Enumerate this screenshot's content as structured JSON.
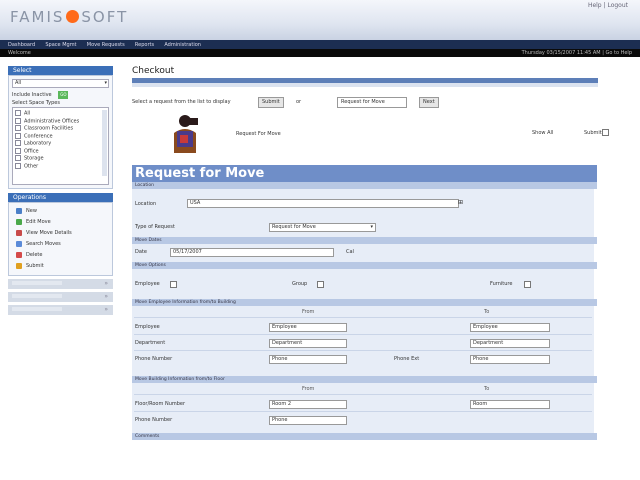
{
  "colors": {
    "accent": "#3b6fb8",
    "banner": "#6f8ec8",
    "logo_dot": "#ff6a1a",
    "nav_dark": "#1c2e52"
  },
  "header": {
    "logo_left": "FAMIS",
    "logo_right": "SOFT",
    "right_links": "Help | Logout"
  },
  "topnav": {
    "items": [
      "Dashboard",
      "Space Mgmt",
      "Move Requests",
      "Reports",
      "Administration"
    ]
  },
  "subbar": {
    "left": "Welcome",
    "right": "Thursday 03/15/2007 11:45 AM | Go to Help"
  },
  "sidebar": {
    "select_title": "Select",
    "select_value": "All",
    "include_label": "Include Inactive",
    "go_label": "GO",
    "list_label": "Select Space Types",
    "list_items": [
      "All",
      "Administrative Offices",
      "Classroom Facilities",
      "Conference",
      "Laboratory",
      "Office",
      "Storage",
      "Other"
    ],
    "ops_title": "Operations",
    "ops_items": [
      {
        "label": "New",
        "color": "#4a7fc8"
      },
      {
        "label": "Edit Move",
        "color": "#4aa84a"
      },
      {
        "label": "View Move Details",
        "color": "#c84a4a"
      },
      {
        "label": "Search Moves",
        "color": "#5a8ad8"
      },
      {
        "label": "Delete",
        "color": "#d44a4a"
      },
      {
        "label": "Submit",
        "color": "#e0a020"
      }
    ],
    "collapsed_1": "",
    "collapsed_2": "",
    "collapsed_3": ""
  },
  "main": {
    "page_title": "Checkout",
    "toolbar": {
      "prompt": "Select a request from the list to display",
      "go_label": "Submit",
      "or_label": "or",
      "select_value": "Request for Move",
      "next_label": "Next"
    },
    "request_for_label": "Request For Move",
    "status_label": "Show All",
    "reserve_label": "Submit"
  },
  "form": {
    "banner": "Request for Move",
    "section_location": "Location",
    "location_label": "Location",
    "location_value": "USA",
    "type_label": "Type of Request",
    "type_value": "Request for Move",
    "section_dates": "Move Dates",
    "date_label": "Date",
    "date_value": "05/17/2007",
    "date_suffix": "Cal",
    "section_options": "Move Options",
    "opt1": "Employee",
    "opt2": "Group",
    "opt3": "Furniture",
    "section_employee": "Move Employee Information from/to Building",
    "from_label": "From",
    "to_label": "To",
    "rows": [
      {
        "label": "Employee",
        "from": "Employee",
        "to": "Employee"
      },
      {
        "label": "Department",
        "from": "Department",
        "to": "Department"
      },
      {
        "label": "Phone Number",
        "from": "Phone",
        "to": "Phone"
      }
    ],
    "extra_label": "Phone Ext",
    "section_building": "Move Building Information from/to Floor",
    "from2_label": "From",
    "to2_label": "To",
    "building_rows": [
      {
        "label": "Floor/Room Number",
        "from": "Room 2",
        "to": "Room"
      },
      {
        "label": "Phone Number",
        "from": "Phone"
      }
    ],
    "footer_section": "Comments"
  }
}
